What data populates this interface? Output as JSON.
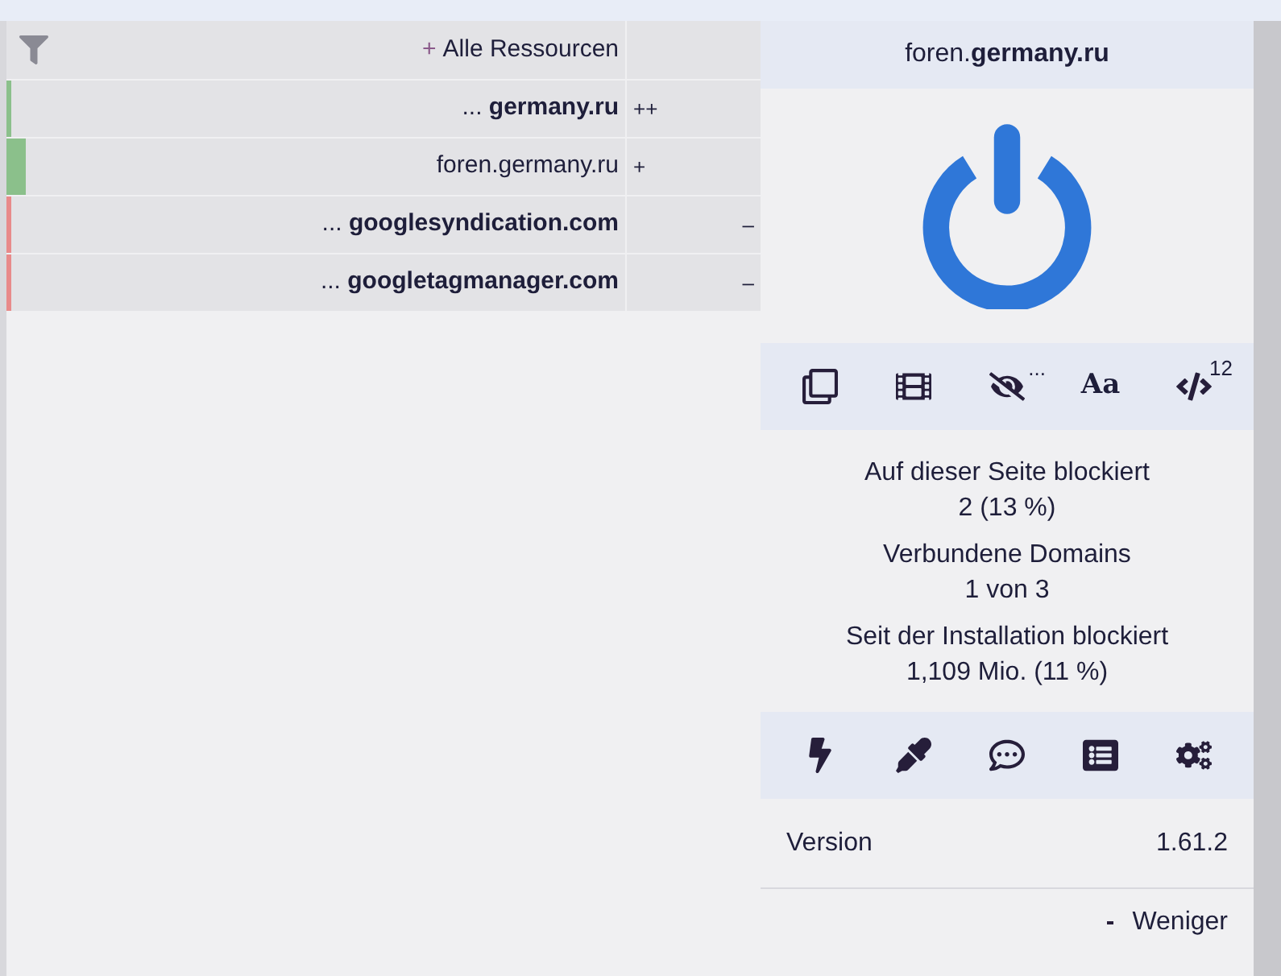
{
  "filter_header": {
    "plus": "+",
    "label": "Alle Ressourcen"
  },
  "rows": [
    {
      "kind": "allowed-domain",
      "color": "#8bc08b",
      "text": "... **germany.ru**",
      "rule": "++"
    },
    {
      "kind": "allowed-host",
      "color": "#8bc08b",
      "text": "foren.germany.ru",
      "rule": "+"
    },
    {
      "kind": "blocked-domain",
      "color": "#e88a8a",
      "text": "... **googlesyndication.com**",
      "rule": "–"
    },
    {
      "kind": "blocked-domain",
      "color": "#e88a8a",
      "text": "... **googletagmanager.com**",
      "rule": "–"
    }
  ],
  "hostname": "foren.**germany.ru**",
  "power": {
    "on": true
  },
  "tools": [
    {
      "kind": "popups"
    },
    {
      "kind": "media"
    },
    {
      "kind": "cosmetic",
      "badge": "..."
    },
    {
      "kind": "fonts",
      "label": "Aa"
    },
    {
      "kind": "scripts",
      "badge": "12"
    }
  ],
  "stats": [
    {
      "label": "Auf dieser Seite blockiert",
      "value": "2 (13 %)"
    },
    {
      "label": "Verbundene Domains",
      "value": "1 von 3"
    },
    {
      "label": "Seit der Installation blockiert",
      "value": "1,109 Mio. (11 %)"
    }
  ],
  "actions": [
    {
      "kind": "zap"
    },
    {
      "kind": "picker"
    },
    {
      "kind": "report"
    },
    {
      "kind": "logger"
    },
    {
      "kind": "settings"
    }
  ],
  "version": {
    "label": "Version",
    "value": "1.61.2"
  },
  "less": "Weniger"
}
